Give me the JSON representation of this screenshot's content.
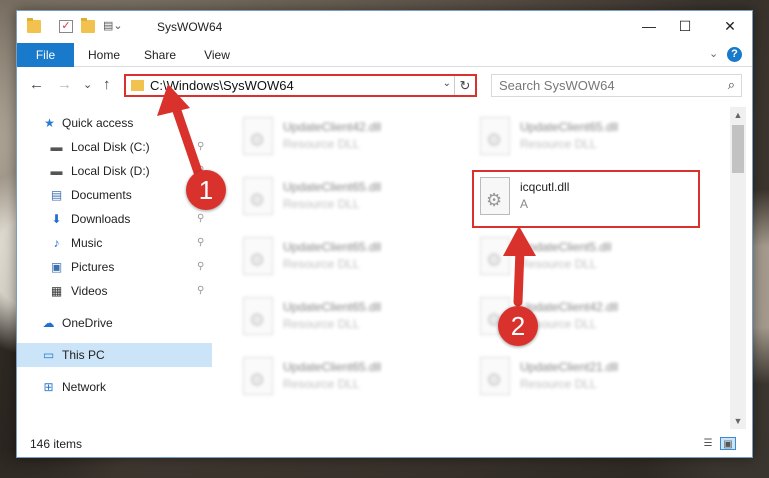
{
  "window": {
    "title": "SysWOW64",
    "controls": {
      "minimize": "—",
      "maximize": "☐",
      "close": "✕"
    }
  },
  "ribbon": {
    "tabs": [
      "File",
      "Home",
      "Share",
      "View"
    ],
    "expand_glyph": "⌄",
    "help_glyph": "?"
  },
  "navigation": {
    "back": "←",
    "forward": "→",
    "recent": "⌄",
    "up": "↑",
    "address": "C:\\Windows\\SysWOW64",
    "address_dropdown": "⌄",
    "refresh": "↻",
    "search_placeholder": "Search SysWOW64",
    "search_glyph": "⌕"
  },
  "sidebar": {
    "items": [
      {
        "label": "Quick access",
        "icon": "star-icon",
        "glyph": "★",
        "color": "#2b79d0",
        "pinned": false
      },
      {
        "label": "Local Disk (C:)",
        "icon": "drive-icon",
        "glyph": "▬",
        "color": "#555555",
        "pinned": true
      },
      {
        "label": "Local Disk (D:)",
        "icon": "drive-icon",
        "glyph": "▬",
        "color": "#555555",
        "pinned": true
      },
      {
        "label": "Documents",
        "icon": "documents-icon",
        "glyph": "▤",
        "color": "#3a6fb0",
        "pinned": true
      },
      {
        "label": "Downloads",
        "icon": "download-icon",
        "glyph": "⬇",
        "color": "#1f6fcf",
        "pinned": true
      },
      {
        "label": "Music",
        "icon": "music-icon",
        "glyph": "♪",
        "color": "#1f6fcf",
        "pinned": true
      },
      {
        "label": "Pictures",
        "icon": "pictures-icon",
        "glyph": "▣",
        "color": "#3a6fb0",
        "pinned": true
      },
      {
        "label": "Videos",
        "icon": "video-icon",
        "glyph": "▦",
        "color": "#333333",
        "pinned": true
      },
      {
        "label": "OneDrive",
        "icon": "cloud-icon",
        "glyph": "☁",
        "color": "#1f6fcf",
        "pinned": false
      },
      {
        "label": "This PC",
        "icon": "computer-icon",
        "glyph": "▭",
        "color": "#2b79d0",
        "pinned": false,
        "selected": true
      },
      {
        "label": "Network",
        "icon": "network-icon",
        "glyph": "⊞",
        "color": "#2b79d0",
        "pinned": false
      }
    ],
    "pin_glyph": "📌"
  },
  "files": [
    {
      "name": "UpdateClient42.dll",
      "type": "Resource DLL",
      "blurred": true
    },
    {
      "name": "UpdateClient65.dll",
      "type": "Resource DLL",
      "blurred": true
    },
    {
      "name": "UpdateClient65.dll",
      "type": "Resource DLL",
      "blurred": true
    },
    {
      "name": "icqcutl.dll",
      "type": "A",
      "blurred": false
    },
    {
      "name": "UpdateClient65.dll",
      "type": "Resource DLL",
      "blurred": true
    },
    {
      "name": "UpdateClient5.dll",
      "type": "Resource DLL",
      "blurred": true
    },
    {
      "name": "UpdateClient65.dll",
      "type": "Resource DLL",
      "blurred": true
    },
    {
      "name": "UpdateClient42.dll",
      "type": "Resource DLL",
      "blurred": true
    },
    {
      "name": "UpdateClient65.dll",
      "type": "Resource DLL",
      "blurred": true
    },
    {
      "name": "UpdateClient21.dll",
      "type": "Resource DLL",
      "blurred": true
    }
  ],
  "status": {
    "item_count": "146 items"
  },
  "annotations": {
    "step1": "1",
    "step2": "2",
    "accent_color": "#d9312c"
  },
  "colors": {
    "file_tab": "#1979ca",
    "selected_nav": "#cce4f7"
  }
}
